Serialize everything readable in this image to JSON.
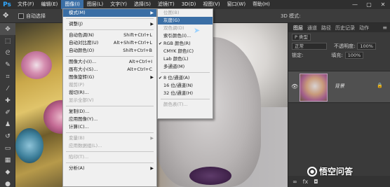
{
  "app": {
    "logo": "Ps"
  },
  "menubar": {
    "items": [
      "文件(F)",
      "编辑(E)",
      "图像(I)",
      "图层(L)",
      "文字(Y)",
      "选择(S)",
      "滤镜(T)",
      "3D(D)",
      "视图(V)",
      "窗口(W)",
      "帮助(H)"
    ],
    "active": "图像(I)",
    "window_controls": [
      "—",
      "▢",
      "✕"
    ]
  },
  "options_bar": {
    "auto_select_label": "自动选择",
    "mode_3d_label": "3D 模式:"
  },
  "image_menu": {
    "items": [
      {
        "label": "模式(M)",
        "submenu": true,
        "highlight": true
      },
      {
        "sep": true
      },
      {
        "label": "调整(J)",
        "submenu": true
      },
      {
        "sep": true
      },
      {
        "label": "自动色调(N)",
        "shortcut": "Shift+Ctrl+L"
      },
      {
        "label": "自动对比度(U)",
        "shortcut": "Alt+Shift+Ctrl+L"
      },
      {
        "label": "自动颜色(O)",
        "shortcut": "Shift+Ctrl+B"
      },
      {
        "sep": true
      },
      {
        "label": "图像大小(I)...",
        "shortcut": "Alt+Ctrl+I"
      },
      {
        "label": "画布大小(S)...",
        "shortcut": "Alt+Ctrl+C"
      },
      {
        "label": "图像旋转(G)",
        "submenu": true
      },
      {
        "label": "裁剪(P)",
        "disabled": true
      },
      {
        "label": "裁切(R)..."
      },
      {
        "label": "显示全部(V)",
        "disabled": true
      },
      {
        "sep": true
      },
      {
        "label": "复制(D)..."
      },
      {
        "label": "应用图像(Y)..."
      },
      {
        "label": "计算(C)..."
      },
      {
        "sep": true
      },
      {
        "label": "变量(B)",
        "submenu": true,
        "disabled": true
      },
      {
        "label": "应用数据组(L)...",
        "disabled": true
      },
      {
        "sep": true
      },
      {
        "label": "陷印(T)...",
        "disabled": true
      },
      {
        "sep": true
      },
      {
        "label": "分析(A)",
        "submenu": true
      }
    ]
  },
  "mode_submenu": {
    "items": [
      {
        "label": "位图(B)",
        "disabled": true
      },
      {
        "label": "灰度(G)",
        "highlight": true
      },
      {
        "label": "双色调(D)",
        "disabled": true
      },
      {
        "label": "索引颜色(I)...",
        "disabled": false
      },
      {
        "label": "RGB 颜色(R)",
        "checked": true
      },
      {
        "label": "CMYK 颜色(C)"
      },
      {
        "label": "Lab 颜色(L)"
      },
      {
        "label": "多通道(M)"
      },
      {
        "sep": true
      },
      {
        "label": "8 位/通道(A)",
        "checked": true
      },
      {
        "label": "16 位/通道(N)"
      },
      {
        "label": "32 位/通道(H)"
      },
      {
        "sep": true
      },
      {
        "label": "颜色表(T)...",
        "disabled": true
      }
    ]
  },
  "layers_panel": {
    "tabs": [
      "图层",
      "通道",
      "路径",
      "历史记录",
      "动作"
    ],
    "active_tab": "图层",
    "kind_filter": "P 类型",
    "blend_mode": "正常",
    "opacity_label": "不透明度:",
    "opacity_value": "100%",
    "lock_label": "锁定:",
    "fill_label": "填充:",
    "fill_value": "100%",
    "layer_name": "背景"
  },
  "watermark": {
    "text": "悟空问答"
  },
  "colors": {
    "accent": "#3a6ea5",
    "menubar": "#2f2f2f",
    "panel": "#3a3a3a"
  }
}
